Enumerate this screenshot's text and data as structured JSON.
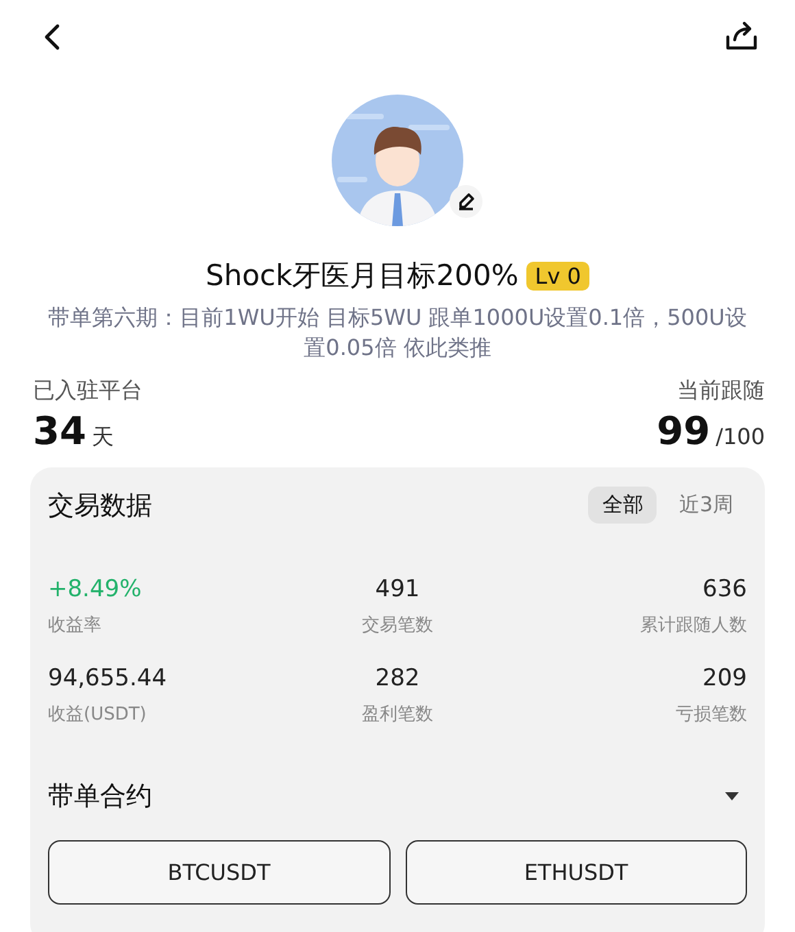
{
  "profile": {
    "name": "Shock牙医月目标200%",
    "level_badge": "Lv 0",
    "description": "带单第六期：目前1WU开始 目标5WU 跟单1000U设置0.1倍，500U设置0.05倍 依此类推"
  },
  "summary": {
    "joined_label": "已入驻平台",
    "joined_value": "34",
    "joined_unit": "天",
    "following_label": "当前跟随",
    "following_value": "99",
    "following_limit": "/100"
  },
  "trading_data": {
    "title": "交易数据",
    "periods": [
      {
        "label": "全部",
        "selected": true
      },
      {
        "label": "近3周",
        "selected": false
      }
    ],
    "stats": [
      {
        "value": "+8.49%",
        "label": "收益率",
        "kind": "gain"
      },
      {
        "value": "491",
        "label": "交易笔数",
        "kind": "plain"
      },
      {
        "value": "636",
        "label": "累计跟随人数",
        "kind": "plain"
      },
      {
        "value": "94,655.44",
        "label": "收益(USDT)",
        "kind": "plain"
      },
      {
        "value": "282",
        "label": "盈利笔数",
        "kind": "plain"
      },
      {
        "value": "209",
        "label": "亏损笔数",
        "kind": "plain"
      }
    ],
    "contracts_title": "带单合约",
    "contracts": [
      "BTCUSDT",
      "ETHUSDT"
    ]
  }
}
